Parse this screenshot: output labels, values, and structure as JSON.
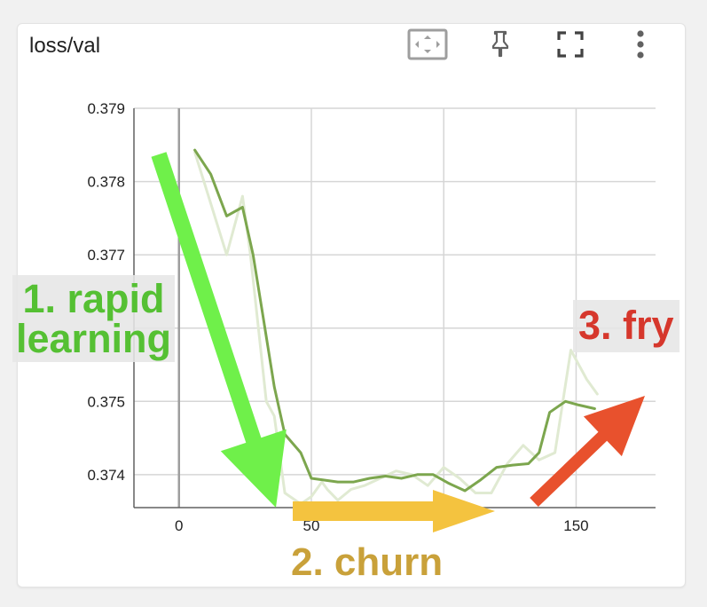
{
  "card": {
    "title": "loss/val"
  },
  "toolbar": {
    "fit_icon": "fit-to-data-icon",
    "pin_icon": "pin-icon",
    "fullscreen_icon": "fullscreen-icon",
    "menu_icon": "more-vert-icon"
  },
  "annotations": {
    "a1_line1": "1. rapid",
    "a1_line2": "learning",
    "a2": "2. churn",
    "a3": "3. fry"
  },
  "colors": {
    "smoothed": "#7ca64e",
    "raw": "#e0ead2",
    "arrow_green": "#6ff04a",
    "arrow_yellow": "#f4c33f",
    "arrow_red": "#e8512d",
    "text_green": "#55c033",
    "text_yellow": "#c9a13a",
    "text_red": "#d6372c"
  },
  "chart_data": {
    "type": "line",
    "title": "loss/val",
    "xlabel": "",
    "ylabel": "",
    "xlim": [
      -17,
      180
    ],
    "ylim": [
      0.37355,
      0.379
    ],
    "x_ticks": [
      0,
      50,
      100,
      150
    ],
    "x_tick_labels": [
      "0",
      "50",
      "",
      "150"
    ],
    "y_ticks": [
      0.374,
      0.375,
      0.376,
      0.377,
      0.378,
      0.379
    ],
    "y_tick_labels": [
      "0.374",
      "0.375",
      "",
      "0.377",
      "0.378",
      "0.379"
    ],
    "grid": true,
    "series": [
      {
        "role": "raw",
        "x": [
          6,
          12,
          18,
          24,
          27,
          30,
          33,
          36,
          40,
          46,
          50,
          54,
          56,
          60,
          65,
          70,
          76,
          82,
          88,
          94,
          100,
          106,
          112,
          118,
          124,
          130,
          136,
          142,
          148,
          154,
          158
        ],
        "y": [
          0.3784,
          0.3777,
          0.377,
          0.3778,
          0.377,
          0.376,
          0.375,
          0.3748,
          0.37375,
          0.3736,
          0.3737,
          0.3739,
          0.3738,
          0.37365,
          0.3738,
          0.37385,
          0.37395,
          0.37405,
          0.374,
          0.37385,
          0.3741,
          0.37395,
          0.37375,
          0.37375,
          0.37415,
          0.3744,
          0.3742,
          0.3743,
          0.3757,
          0.3753,
          0.3751
        ]
      },
      {
        "role": "smoothed",
        "x": [
          6,
          12,
          18,
          24,
          28,
          32,
          36,
          40,
          46,
          50,
          54,
          60,
          66,
          72,
          78,
          84,
          90,
          96,
          102,
          108,
          114,
          120,
          126,
          132,
          136,
          140,
          146,
          151,
          157
        ],
        "y": [
          0.37843,
          0.3781,
          0.37753,
          0.37765,
          0.377,
          0.3761,
          0.3752,
          0.37455,
          0.3743,
          0.37395,
          0.37393,
          0.3739,
          0.3739,
          0.37395,
          0.37398,
          0.37395,
          0.374,
          0.374,
          0.37388,
          0.37378,
          0.37393,
          0.3741,
          0.37413,
          0.37415,
          0.3743,
          0.37485,
          0.375,
          0.37495,
          0.3749
        ]
      }
    ]
  }
}
